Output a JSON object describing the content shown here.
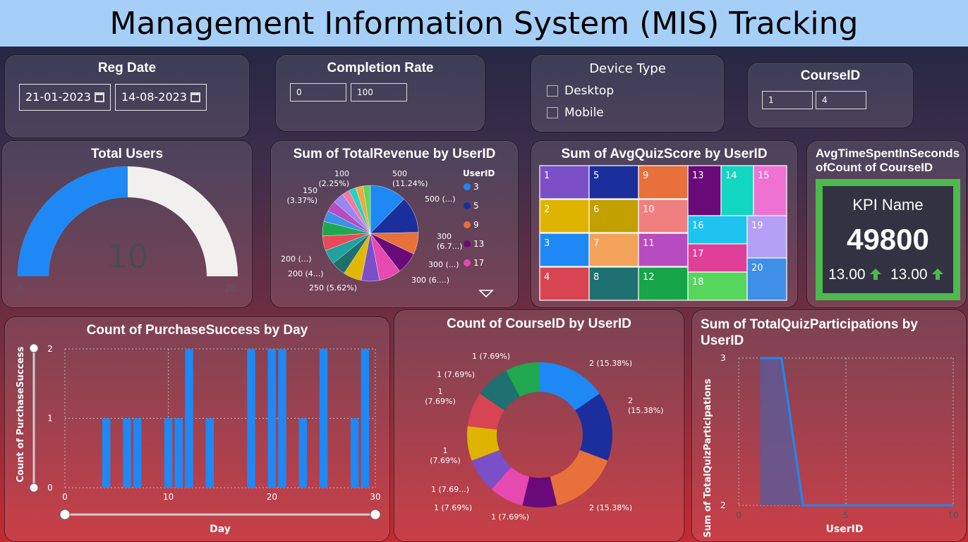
{
  "header": {
    "title": "Management Information System (MIS) Tracking"
  },
  "colors": {
    "title_bar": "#a5cff7",
    "accent_blue": "#1e88f5",
    "kpi_green": "#4cbb4c",
    "background_top": "#1d2541",
    "background_bottom": "#c42a33"
  },
  "filters": {
    "reg_date": {
      "title": "Reg Date",
      "start": "21-01-2023",
      "end": "14-08-2023"
    },
    "completion_rate": {
      "title": "Completion Rate",
      "min": "0",
      "max": "100"
    },
    "device_type": {
      "title": "Device Type",
      "options": [
        "Desktop",
        "Mobile"
      ]
    },
    "course_id": {
      "title": "CourseID",
      "min": "1",
      "max": "4"
    }
  },
  "total_users": {
    "title": "Total Users",
    "value": "10",
    "min_label": "0",
    "max_label": "20",
    "chart_data": {
      "type": "gauge",
      "value": 10,
      "min": 0,
      "max": 20
    }
  },
  "revenue_pie": {
    "title": "Sum of TotalRevenue by UserID",
    "legend_title": "UserID",
    "legend_items": [
      {
        "label": "3",
        "color": "#1e88f5"
      },
      {
        "label": "5",
        "color": "#1a2e9c"
      },
      {
        "label": "9",
        "color": "#e8703a"
      },
      {
        "label": "13",
        "color": "#6a0a78"
      },
      {
        "label": "17",
        "color": "#e649b0"
      }
    ],
    "labels": [
      "500\n(11.24%)",
      "500 (...)",
      "300\n(6.7...)",
      "300 (...)",
      "300 (6....)",
      "250 (5.62%)",
      "200 (4...)",
      "200 (...)",
      "150\n(3.37%)",
      "100\n(2.25%)"
    ],
    "chart_data": {
      "type": "pie",
      "slices": [
        {
          "color": "#1e88f5",
          "value": 500
        },
        {
          "color": "#1a2e9c",
          "value": 500
        },
        {
          "color": "#e8703a",
          "value": 300
        },
        {
          "color": "#6a0a78",
          "value": 300
        },
        {
          "color": "#e649b0",
          "value": 300
        },
        {
          "color": "#7b4fc7",
          "value": 250
        },
        {
          "color": "#e0b800",
          "value": 250
        },
        {
          "color": "#1f6f6f",
          "value": 200
        },
        {
          "color": "#20a0a0",
          "value": 200
        },
        {
          "color": "#e84a5a",
          "value": 200
        },
        {
          "color": "#1fa84f",
          "value": 200
        },
        {
          "color": "#3e8fe8",
          "value": 150
        },
        {
          "color": "#b64cc0",
          "value": 150
        },
        {
          "color": "#9a86f0",
          "value": 150
        },
        {
          "color": "#f07aa0",
          "value": 100
        },
        {
          "color": "#2ad1c4",
          "value": 100
        },
        {
          "color": "#f0a840",
          "value": 100
        },
        {
          "color": "#5ed65e",
          "value": 100
        }
      ]
    }
  },
  "quiz_treemap": {
    "title": "Sum of AvgQuizScore by UserID",
    "chart_data": {
      "type": "treemap",
      "cells": [
        {
          "label": "1",
          "color": "#7b4fc7"
        },
        {
          "label": "2",
          "color": "#dfb400"
        },
        {
          "label": "3",
          "color": "#1e88f5"
        },
        {
          "label": "4",
          "color": "#d94452"
        },
        {
          "label": "5",
          "color": "#1a2e9c"
        },
        {
          "label": "6",
          "color": "#c2a000"
        },
        {
          "label": "7",
          "color": "#f4a35a"
        },
        {
          "label": "8",
          "color": "#1f7070"
        },
        {
          "label": "9",
          "color": "#e8703a"
        },
        {
          "label": "10",
          "color": "#f08080"
        },
        {
          "label": "11",
          "color": "#b64cc0"
        },
        {
          "label": "12",
          "color": "#17a54a"
        },
        {
          "label": "13",
          "color": "#6a0a78"
        },
        {
          "label": "14",
          "color": "#12d6bf"
        },
        {
          "label": "15",
          "color": "#ef72d2"
        },
        {
          "label": "16",
          "color": "#1ec4ef"
        },
        {
          "label": "17",
          "color": "#df3f99"
        },
        {
          "label": "18",
          "color": "#55d65d"
        },
        {
          "label": "19",
          "color": "#b4a0f5"
        },
        {
          "label": "20",
          "color": "#3e8fe8"
        }
      ]
    }
  },
  "kpi": {
    "title": "AvgTimeSpentInSeconds ofCount of CourseID",
    "name": "KPI Name",
    "value": "49800",
    "left_sub": "13.00",
    "right_sub": "13.00"
  },
  "purchase_bar": {
    "title": "Count of PurchaseSuccess by Day",
    "xlabel": "Day",
    "ylabel": "Count of PurchaseSuccess",
    "x_ticks": [
      "0",
      "10",
      "20",
      "30"
    ],
    "y_ticks": [
      "0",
      "1",
      "2"
    ],
    "chart_data": {
      "type": "bar",
      "x": [
        4,
        6,
        7,
        10,
        11,
        12,
        14,
        18,
        20,
        21,
        23,
        25,
        28,
        29
      ],
      "values": [
        1,
        1,
        1,
        1,
        1,
        2,
        1,
        2,
        2,
        2,
        1,
        2,
        1,
        2
      ],
      "xlim": [
        0,
        30
      ],
      "ylim": [
        0,
        2
      ],
      "grid": true,
      "xlabel": "Day",
      "ylabel": "Count of PurchaseSuccess",
      "title": "Count of PurchaseSuccess by Day"
    }
  },
  "course_donut": {
    "title": "Count of CourseID by UserID",
    "labels": [
      "2 (15.38%)",
      "2\n(15.38%)",
      "2 (15.38%)",
      "1 (7.69%)",
      "1 (7.69%)",
      "1 (7.69...)",
      "1\n(7.69%)",
      "1\n(7.69%)",
      "1 (7.69%)",
      "1 (7.69%)"
    ],
    "chart_data": {
      "type": "donut",
      "slices": [
        {
          "color": "#1e88f5",
          "value": 2
        },
        {
          "color": "#1a2e9c",
          "value": 2
        },
        {
          "color": "#e8703a",
          "value": 2
        },
        {
          "color": "#6a0a78",
          "value": 1
        },
        {
          "color": "#e649b0",
          "value": 1
        },
        {
          "color": "#7b4fc7",
          "value": 1
        },
        {
          "color": "#dfb400",
          "value": 1
        },
        {
          "color": "#d94452",
          "value": 1
        },
        {
          "color": "#1f7070",
          "value": 1
        },
        {
          "color": "#1fa84f",
          "value": 1
        }
      ]
    }
  },
  "participation_area": {
    "title": "Sum of TotalQuizParticipations by UserID",
    "xlabel": "UserID",
    "ylabel": "Sum of TotalQuizParticipations",
    "x_ticks": [
      "0",
      "5",
      "10"
    ],
    "y_ticks": [
      "2",
      "3"
    ],
    "chart_data": {
      "type": "area",
      "x": [
        1,
        2,
        3,
        4,
        5,
        6,
        7,
        8,
        9,
        10
      ],
      "values": [
        3,
        3,
        2,
        2,
        2,
        2,
        2,
        2,
        2,
        2
      ],
      "xlim": [
        0,
        10
      ],
      "ylim": [
        2,
        3
      ],
      "grid": true,
      "xlabel": "UserID",
      "ylabel": "Sum of TotalQuizParticipations",
      "title": "Sum of TotalQuizParticipations by UserID"
    }
  }
}
